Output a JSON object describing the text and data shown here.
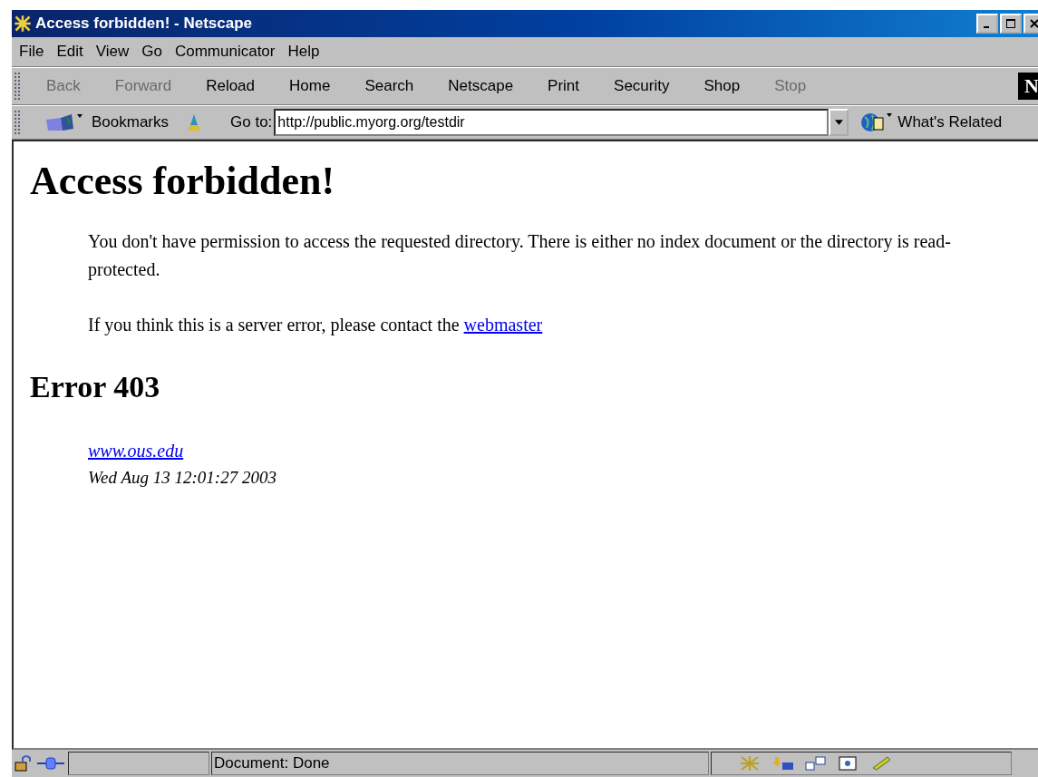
{
  "window": {
    "title": "Access forbidden! - Netscape"
  },
  "menu": [
    "File",
    "Edit",
    "View",
    "Go",
    "Communicator",
    "Help"
  ],
  "toolbar": [
    {
      "label": "Back",
      "disabled": true
    },
    {
      "label": "Forward",
      "disabled": true
    },
    {
      "label": "Reload",
      "disabled": false
    },
    {
      "label": "Home",
      "disabled": false
    },
    {
      "label": "Search",
      "disabled": false
    },
    {
      "label": "Netscape",
      "disabled": false
    },
    {
      "label": "Print",
      "disabled": false
    },
    {
      "label": "Security",
      "disabled": false
    },
    {
      "label": "Shop",
      "disabled": false
    },
    {
      "label": "Stop",
      "disabled": true
    }
  ],
  "logo": "N",
  "location": {
    "bookmarks": "Bookmarks",
    "goto_label": "Go to:",
    "url": "http://public.myorg.org/testdir",
    "related": "What's Related"
  },
  "page": {
    "heading": "Access forbidden!",
    "paragraphs": [
      "You don't have permission to access the requested directory. There is either no index document or the directory is read-protected."
    ],
    "contact_text": "If you think this is a server error, please contact the",
    "contact_link": "webmaster",
    "error_heading": "Error 403",
    "site_link": "www.ous.edu",
    "date": "Wed Aug 13 12:01:27 2003"
  },
  "status_bar": {
    "text": "Document: Done"
  }
}
